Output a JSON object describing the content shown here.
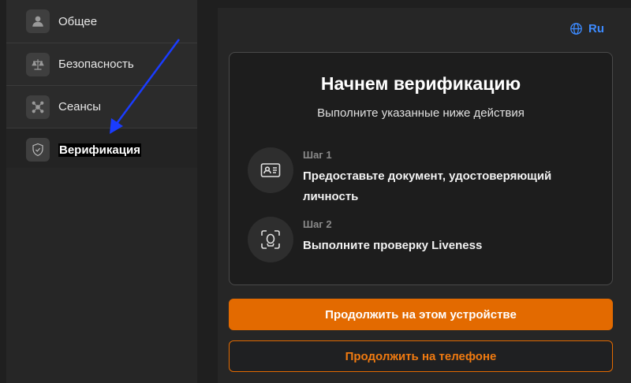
{
  "sidebar": {
    "items": [
      {
        "label": "Общее",
        "icon": "user-icon"
      },
      {
        "label": "Безопасность",
        "icon": "scales-icon"
      },
      {
        "label": "Сеансы",
        "icon": "network-icon"
      },
      {
        "label": "Верификация",
        "icon": "shield-icon"
      }
    ]
  },
  "header": {
    "lang": "Ru"
  },
  "card": {
    "title": "Начнем верификацию",
    "subtitle": "Выполните указанные ниже действия",
    "steps": [
      {
        "num": "Шаг 1",
        "desc": "Предоставьте документ, удостоверяющий личность",
        "icon": "id-card-icon"
      },
      {
        "num": "Шаг 2",
        "desc": "Выполните проверку Liveness",
        "icon": "face-scan-icon"
      }
    ]
  },
  "buttons": {
    "primary": "Продолжить на этом устройстве",
    "secondary": "Продолжить на телефоне"
  },
  "colors": {
    "accent": "#e36a00",
    "link": "#3d8bff",
    "annotation_arrow": "#1a3cff"
  }
}
